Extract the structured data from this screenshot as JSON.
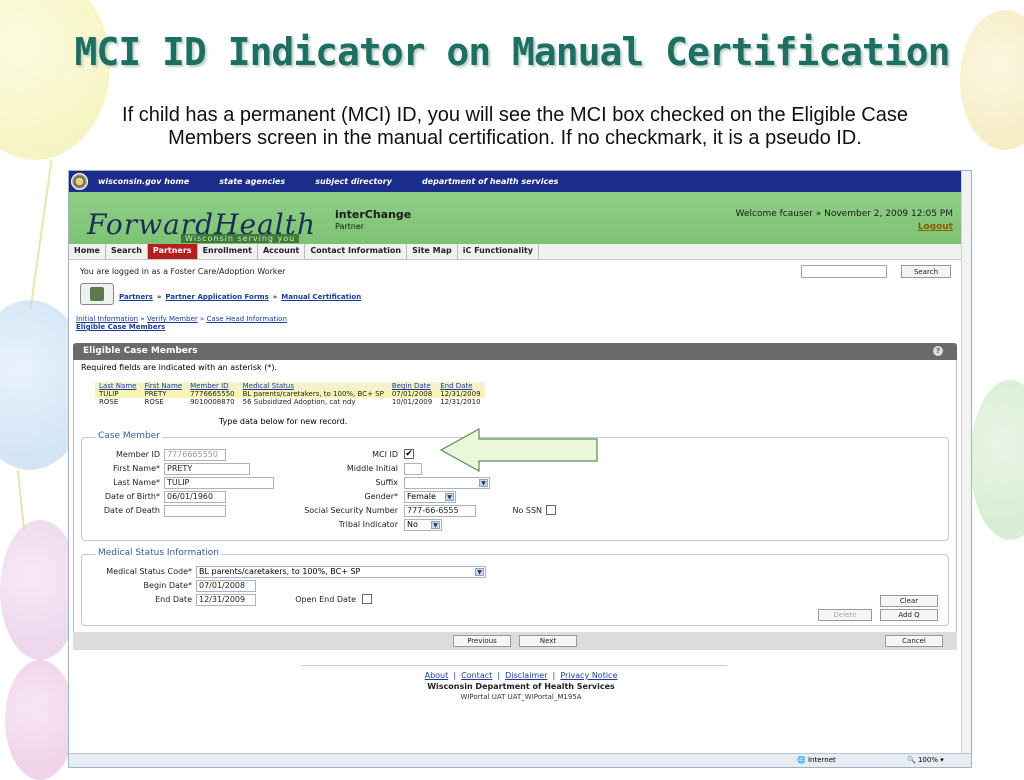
{
  "slide": {
    "title": "MCI ID Indicator on Manual Certification",
    "subtitle": "If child has a permanent (MCI) ID, you will see the MCI box checked on the Eligible Case Members screen in the manual certification. If no checkmark, it is a pseudo ID."
  },
  "topbar": {
    "links": [
      "wisconsin.gov home",
      "state agencies",
      "subject directory",
      "department of health services"
    ]
  },
  "banner": {
    "logo": "ForwardHealth",
    "logo_tag": "Wisconsin serving you",
    "app_title": "interChange",
    "app_sub": "Partner",
    "welcome": "Welcome fcauser » November 2, 2009 12:05 PM",
    "logout": "Logout"
  },
  "nav": {
    "items": [
      "Home",
      "Search",
      "Partners",
      "Enrollment",
      "Account",
      "Contact Information",
      "Site Map",
      "iC Functionality"
    ],
    "active": "Partners"
  },
  "page": {
    "logged_in": "You are logged in as a Foster Care/Adoption Worker",
    "search_button": "Search",
    "breadcrumb": [
      "Partners",
      "Partner Application Forms",
      "Manual Certification"
    ],
    "steps": [
      "Initial Information",
      "Verify Member",
      "Case Head Information"
    ],
    "current_step": "Eligible Case Members"
  },
  "panel": {
    "title": "Eligible Case Members",
    "required_note": "Required fields are indicated with an asterisk (*).",
    "table": {
      "headers": [
        "Last Name",
        "First Name",
        "Member ID",
        "Medical Status",
        "Begin Date",
        "End Date"
      ],
      "rows": [
        [
          "TULIP",
          "PRETY",
          "7776665550",
          "BL parents/caretakers, to 100%, BC+ SP",
          "07/01/2008",
          "12/31/2009"
        ],
        [
          "ROSE",
          "ROSE",
          "9010008870",
          "56 Subsidized Adoption, cat ndy",
          "10/01/2009",
          "12/31/2010"
        ]
      ]
    },
    "type_hint": "Type data below for new record."
  },
  "case_member": {
    "legend": "Case Member",
    "member_id_label": "Member ID",
    "member_id": "7776665550",
    "first_name_label": "First Name*",
    "first_name": "PRETY",
    "last_name_label": "Last Name*",
    "last_name": "TULIP",
    "dob_label": "Date of Birth*",
    "dob": "06/01/1960",
    "dod_label": "Date of Death",
    "mci_label": "MCI ID",
    "mci_checked": "✔",
    "middle_label": "Middle Initial",
    "suffix_label": "Suffix",
    "gender_label": "Gender*",
    "gender": "Female",
    "ssn_label": "Social Security Number",
    "ssn": "777-66-6555",
    "no_ssn_label": "No SSN",
    "tribal_label": "Tribal Indicator",
    "tribal": "No"
  },
  "medical": {
    "legend": "Medical Status Information",
    "code_label": "Medical Status Code*",
    "code": "BL parents/caretakers, to 100%, BC+ SP",
    "begin_label": "Begin Date*",
    "begin": "07/01/2008",
    "end_label": "End Date",
    "end": "12/31/2009",
    "open_end_label": "Open End Date",
    "clear": "Clear",
    "delete": "Delete",
    "add": "Add Q"
  },
  "actions": {
    "previous": "Previous",
    "next": "Next",
    "cancel": "Cancel"
  },
  "footer": {
    "links": [
      "About",
      "Contact",
      "Disclaimer",
      "Privacy Notice"
    ],
    "line1": "Wisconsin Department of Health Services",
    "line2": "WIPortal UAT UAT_WIPortal_M195A"
  },
  "status": {
    "zone": "Internet",
    "zoom": "100%"
  },
  "colors": {
    "title": "#1e6e62",
    "topbar": "#1b2d8a",
    "banner": "#7dc273",
    "active_nav": "#b51f1f",
    "arrow_fill": "#eaf7d8"
  }
}
